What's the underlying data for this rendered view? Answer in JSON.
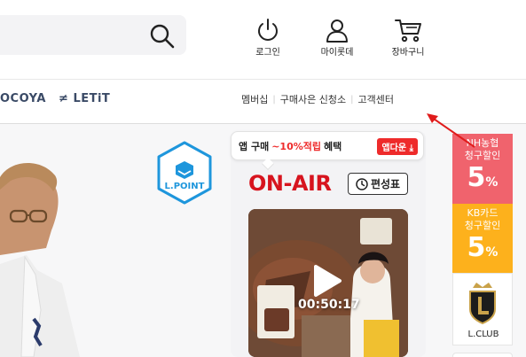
{
  "header": {
    "util": {
      "login": "로그인",
      "mylotte": "마이롯데",
      "cart": "장바구니"
    }
  },
  "brands": {
    "cocoya": "OCOYA",
    "letit": "LETiT"
  },
  "nav": {
    "membership": "멤버십",
    "seller_apply": "구매사은 신청소",
    "customer_center": "고객센터"
  },
  "colors": {
    "accent_red": "#d7141e",
    "nh_bg": "#f0636d",
    "kb_bg": "#fdb11c",
    "lpoint_blue": "#1e96dc",
    "annotation_red": "#e01b1b"
  },
  "lpoint": {
    "label": "L.POINT"
  },
  "live": {
    "app_prefix": "앱 구매",
    "app_highlight": "~10%적립",
    "app_suffix": "혜택",
    "app_download": "앱다운",
    "on_air": "ON-AIR",
    "schedule": "편성표",
    "timer": "00:50:17"
  },
  "promos": {
    "nh": {
      "line1": "NH농협",
      "line2": "청구할인",
      "percent": "5"
    },
    "kb": {
      "line1": "KB카드",
      "line2": "청구할인",
      "percent": "5"
    },
    "percent_sign": "%",
    "lclub": "L.CLUB"
  }
}
